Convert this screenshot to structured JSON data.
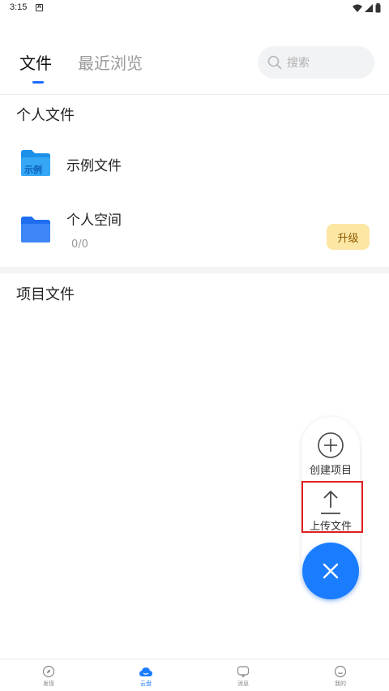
{
  "status_bar": {
    "time": "3:15",
    "notif_letter": "A"
  },
  "tabs": {
    "files": "文件",
    "recent": "最近浏览"
  },
  "search": {
    "placeholder": "搜索"
  },
  "personal": {
    "title": "个人文件",
    "items": [
      {
        "name": "示例文件",
        "badge": "示例"
      },
      {
        "name": "个人空间",
        "usage": "0/0",
        "action": "升级"
      }
    ]
  },
  "project": {
    "title": "项目文件"
  },
  "fab": {
    "create_label": "创建项目",
    "upload_label": "上传文件"
  },
  "nav": {
    "items": [
      {
        "label": "发现"
      },
      {
        "label": "云盘"
      },
      {
        "label": "消息"
      },
      {
        "label": "我的"
      }
    ]
  },
  "colors": {
    "accent": "#1a7cff",
    "highlight": "#e02020",
    "upgrade_bg": "#fce6a4"
  }
}
